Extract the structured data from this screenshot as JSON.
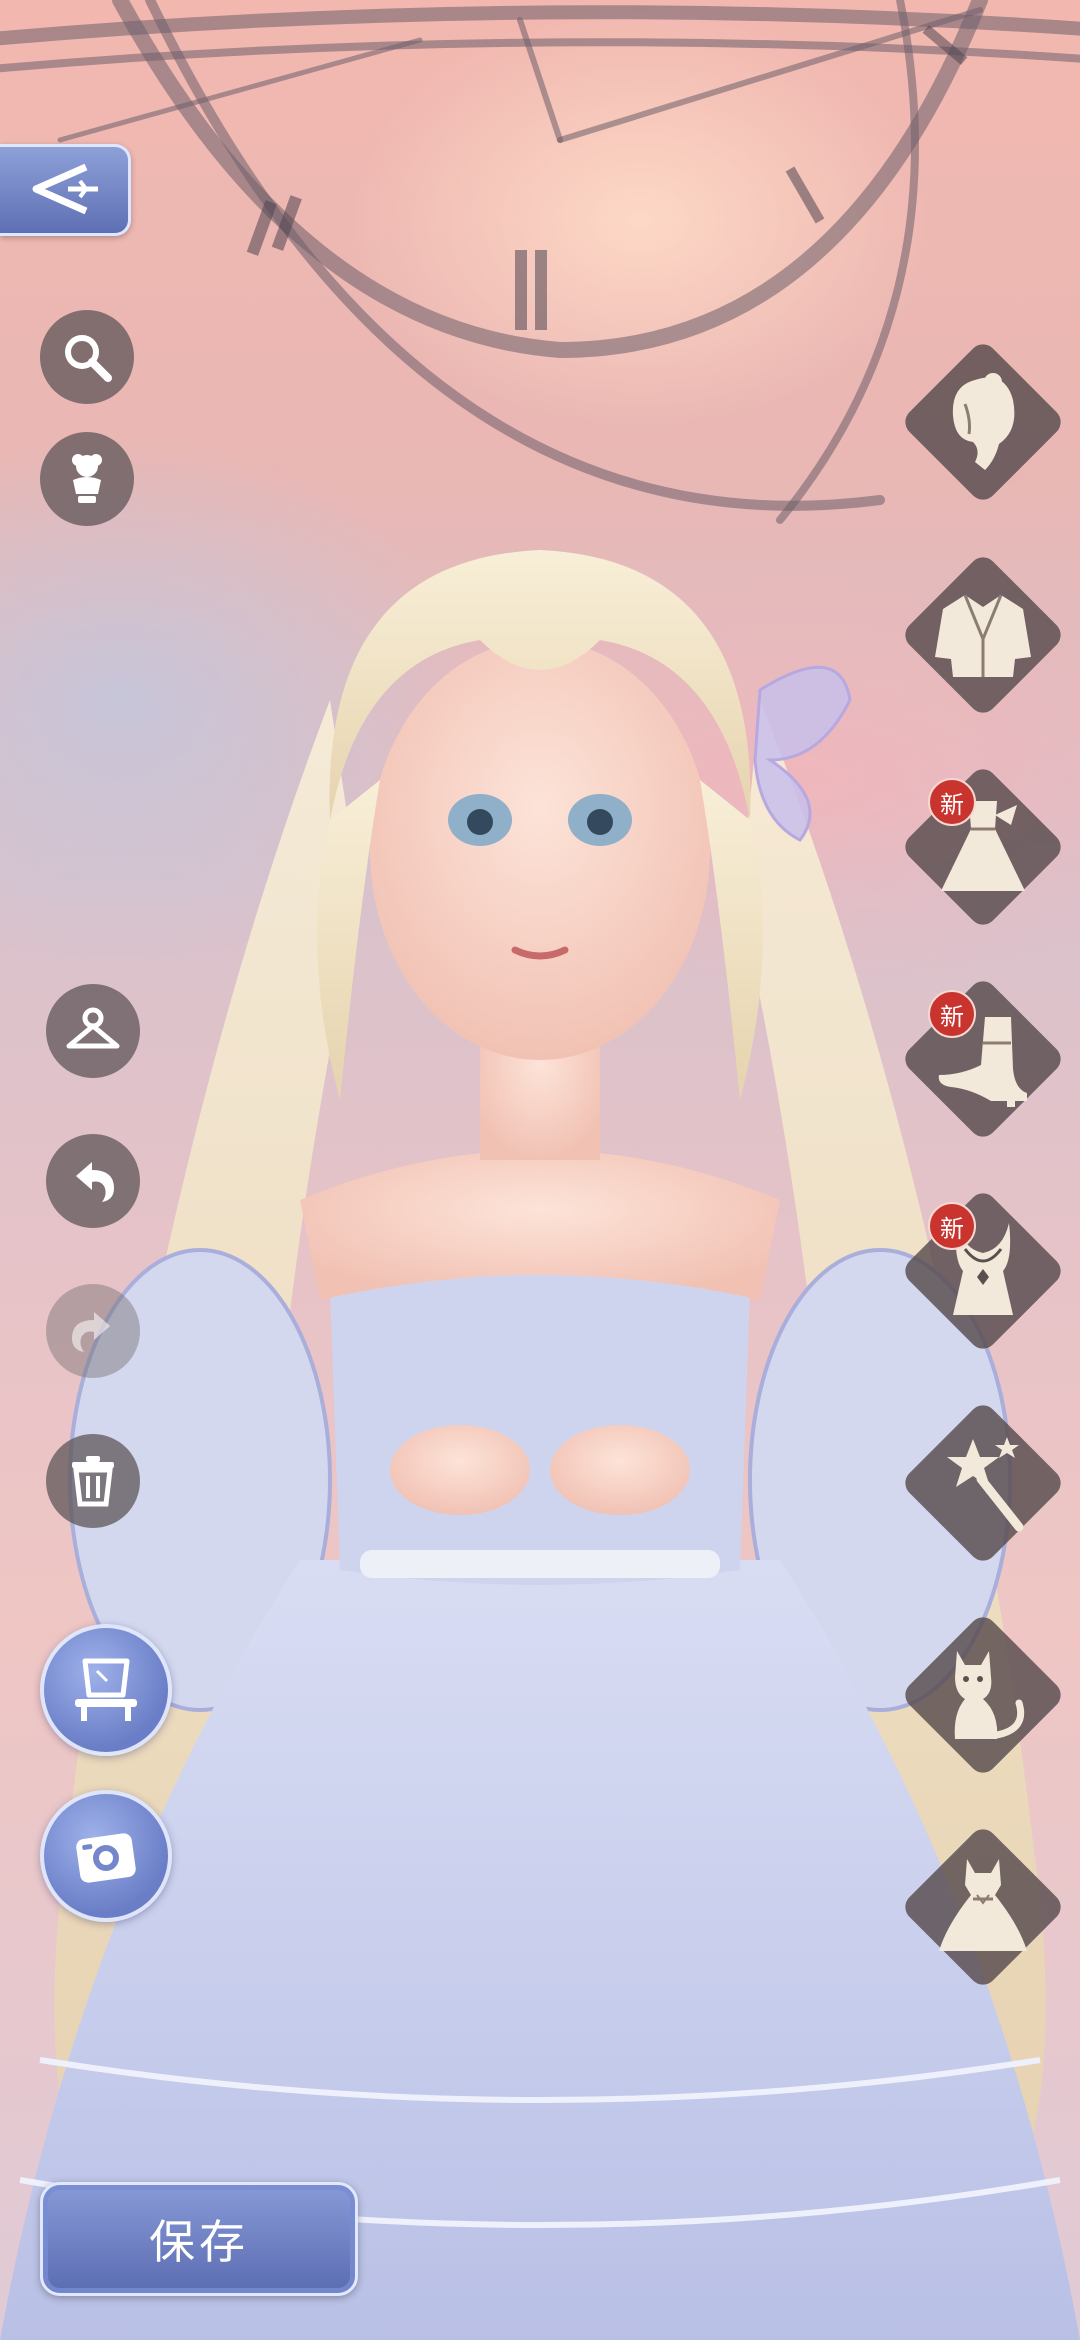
{
  "toolbar": {
    "save_label": "保存",
    "badge_new": "新"
  },
  "left_controls": [
    "back",
    "search",
    "outfit-preview",
    "wardrobe-hanger",
    "undo",
    "redo",
    "delete",
    "dressing-table",
    "camera"
  ],
  "categories": [
    {
      "name": "hair",
      "icon": "hair-icon",
      "is_new": false
    },
    {
      "name": "coat",
      "icon": "coat-icon",
      "is_new": false
    },
    {
      "name": "dress",
      "icon": "dress-icon",
      "is_new": true
    },
    {
      "name": "shoes",
      "icon": "shoe-icon",
      "is_new": true
    },
    {
      "name": "necklace",
      "icon": "necklace-icon",
      "is_new": true
    },
    {
      "name": "wand",
      "icon": "wand-icon",
      "is_new": false
    },
    {
      "name": "pet",
      "icon": "cat-icon",
      "is_new": false
    },
    {
      "name": "full-outfit",
      "icon": "gown-icon",
      "is_new": false
    }
  ],
  "colors": {
    "accent": "#6a7ec7",
    "new_badge": "#c9342e",
    "control_bg": "#5f5558",
    "dress": "#c7cdee"
  }
}
